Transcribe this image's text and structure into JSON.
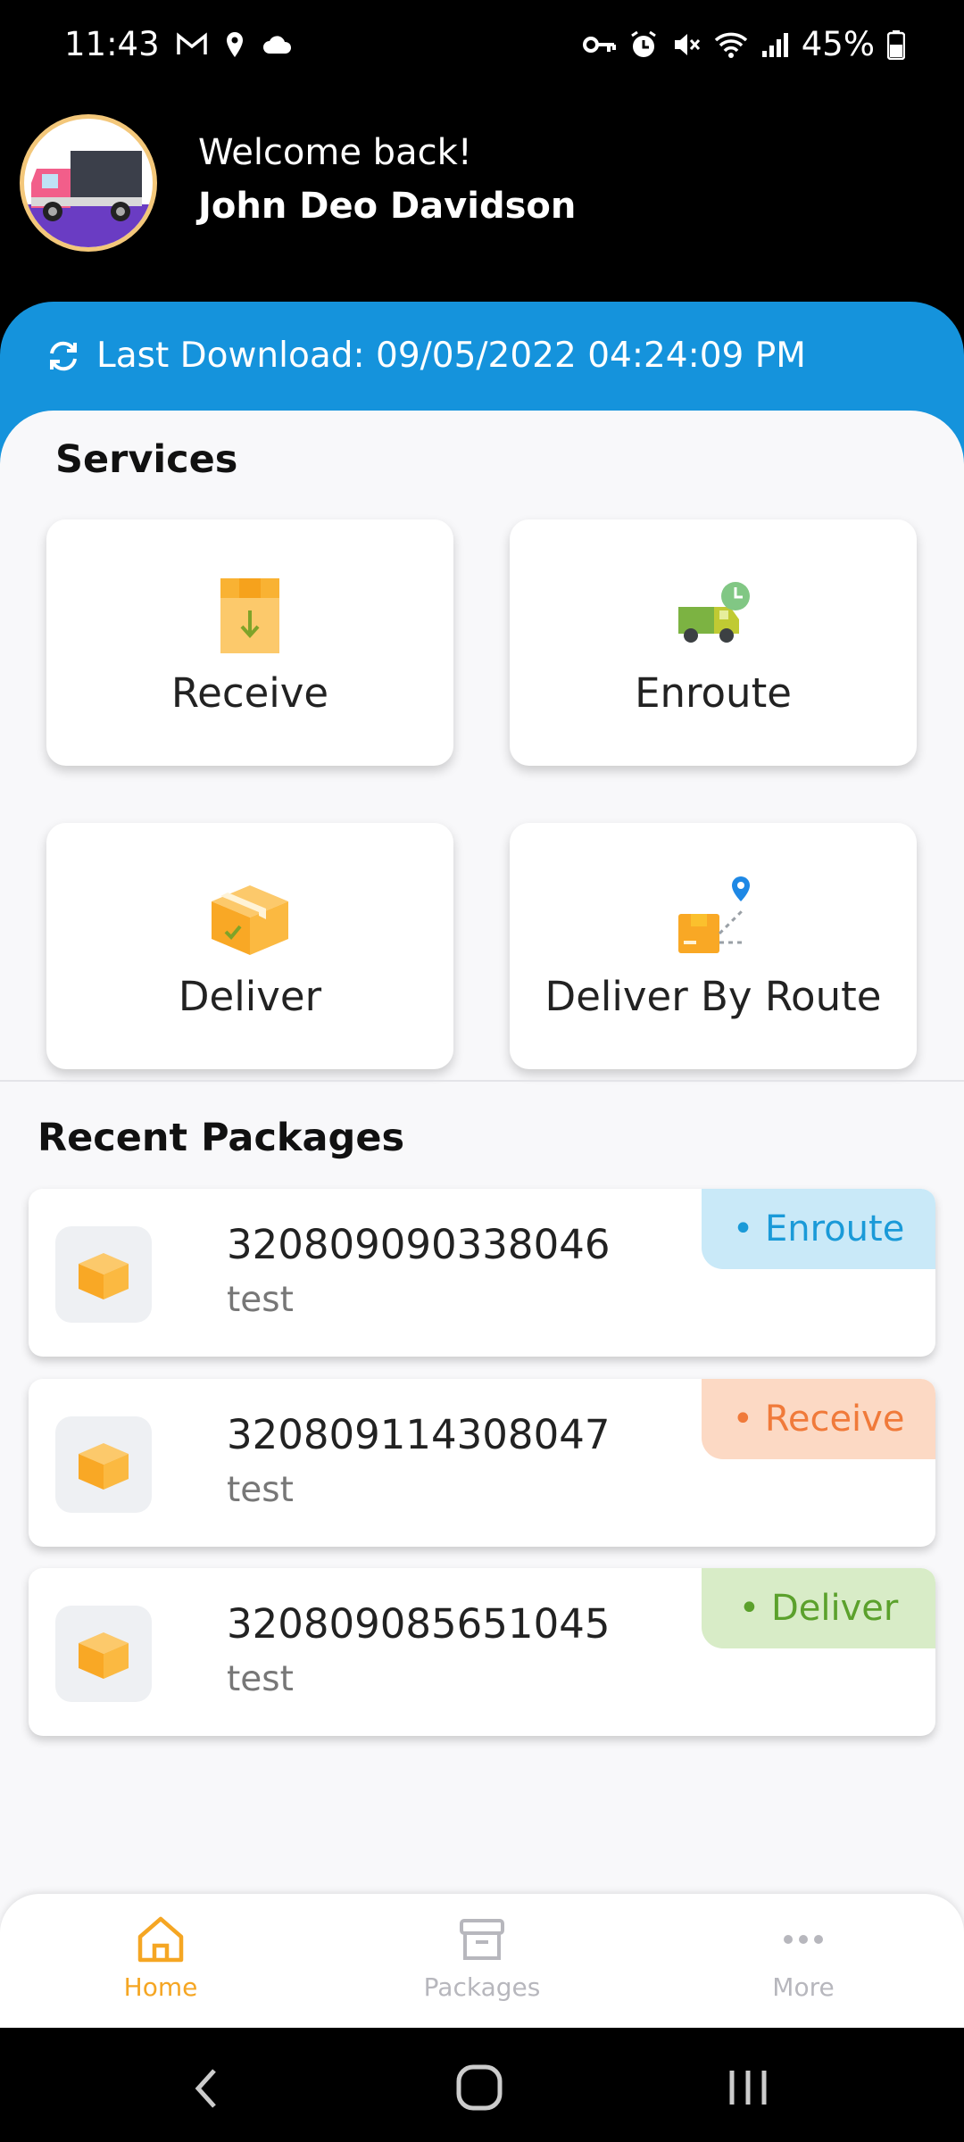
{
  "status_bar": {
    "time": "11:43",
    "battery": "45%",
    "icons_left": [
      "gmail-icon",
      "location-icon",
      "cloud-icon"
    ],
    "icons_right": [
      "vpn-key-icon",
      "alarm-icon",
      "mute-icon",
      "wifi-icon",
      "signal-icon",
      "battery-icon"
    ]
  },
  "header": {
    "welcome": "Welcome back!",
    "user_name": "John Deo Davidson"
  },
  "sync": {
    "text": "Last Download: 09/05/2022 04:24:09 PM"
  },
  "services": {
    "title": "Services",
    "items": [
      {
        "label": "Receive",
        "icon": "box-down-arrow-icon"
      },
      {
        "label": "Enroute",
        "icon": "truck-clock-icon"
      },
      {
        "label": "Deliver",
        "icon": "box-check-icon"
      },
      {
        "label": "Deliver By Route",
        "icon": "box-route-pin-icon"
      }
    ]
  },
  "recent": {
    "title": "Recent Packages",
    "packages": [
      {
        "number": "320809090338046",
        "description": "test",
        "status": "• Enroute"
      },
      {
        "number": "320809114308047",
        "description": "test",
        "status": "• Receive"
      },
      {
        "number": "320809085651045",
        "description": "test",
        "status": "• Deliver"
      }
    ]
  },
  "bottom_nav": {
    "items": [
      {
        "label": "Home",
        "icon": "home-icon",
        "active": true
      },
      {
        "label": "Packages",
        "icon": "archive-box-icon",
        "active": false
      },
      {
        "label": "More",
        "icon": "more-dots-icon",
        "active": false
      }
    ]
  },
  "colors": {
    "primary_blue": "#1593dc",
    "accent_orange": "#f5a623",
    "enroute_bg": "#c9e9f8",
    "enroute_fg": "#1a9ad8",
    "receive_bg": "#fcd9c4",
    "receive_fg": "#f07a3a",
    "deliver_bg": "#d8ecc7",
    "deliver_fg": "#5ba12c"
  }
}
